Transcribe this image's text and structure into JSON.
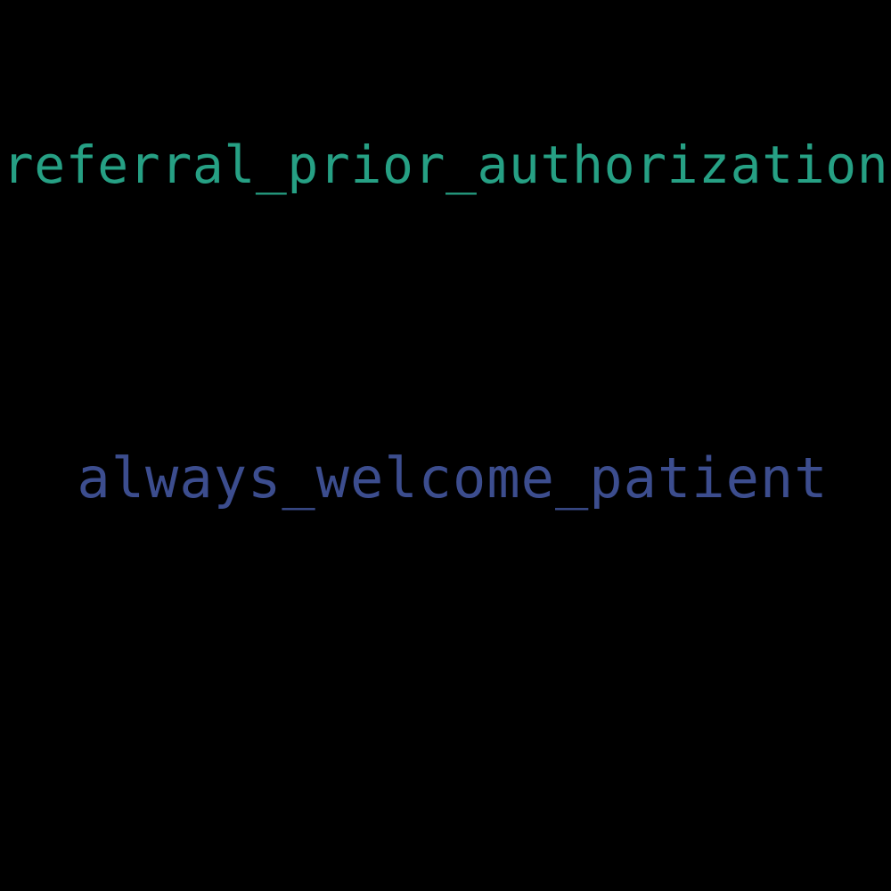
{
  "words": [
    {
      "text": "referral_prior_authorization",
      "color": "#26a084"
    },
    {
      "text": "always_welcome_patient",
      "color": "#3c4d8e"
    }
  ],
  "background_color": "#000000"
}
